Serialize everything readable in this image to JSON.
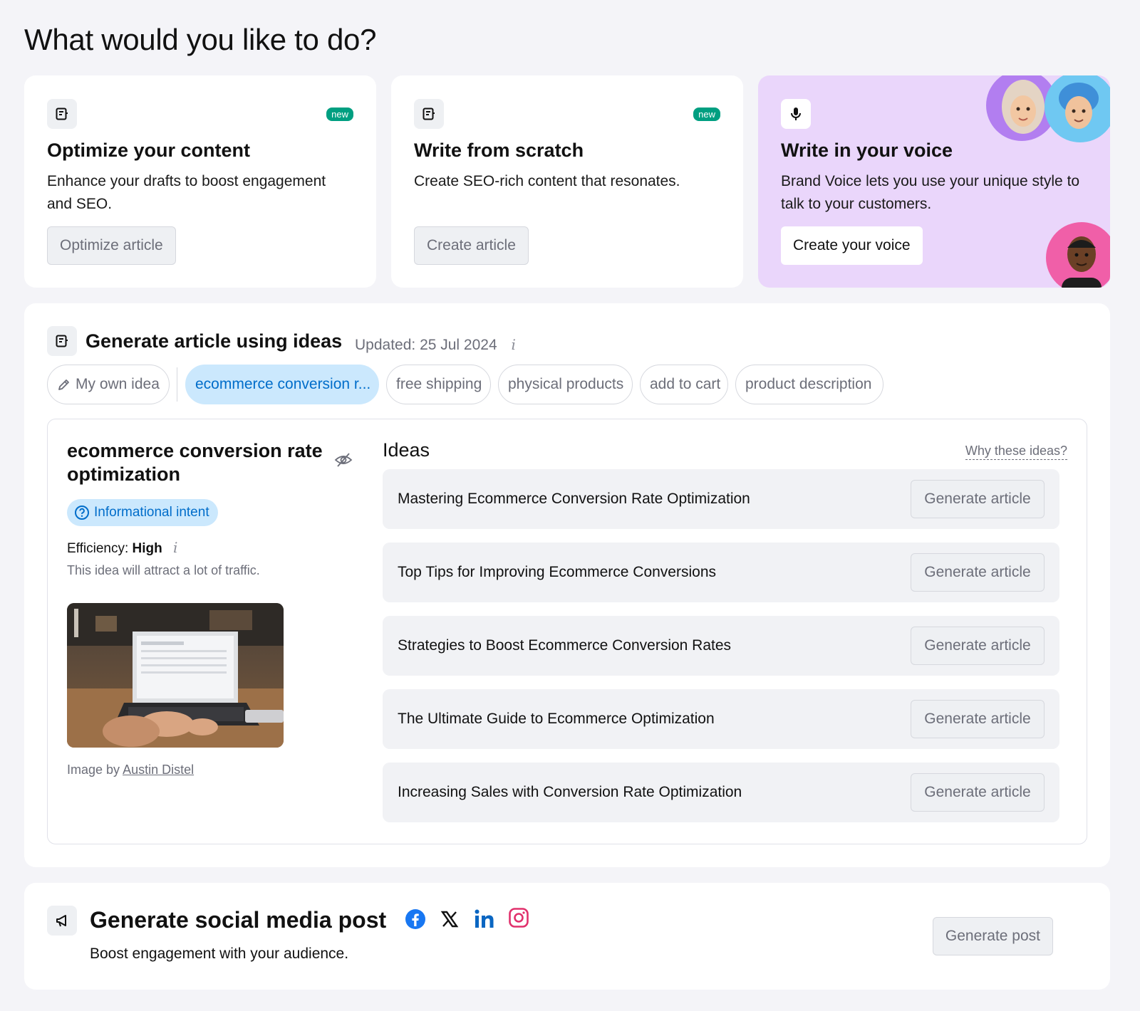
{
  "page": {
    "title": "What would you like to do?"
  },
  "cards": [
    {
      "title": "Optimize your content",
      "badge": "new",
      "description": "Enhance your drafts to boost engagement and SEO.",
      "button": "Optimize article",
      "icon": "document-icon"
    },
    {
      "title": "Write from scratch",
      "badge": "new",
      "description": "Create SEO-rich content that resonates.",
      "button": "Create article",
      "icon": "document-icon"
    },
    {
      "title": "Write in your voice",
      "description": "Brand Voice lets you use your unique style to talk to your customers.",
      "button": "Create your voice",
      "icon": "microphone-icon",
      "background": "#ead6fb"
    }
  ],
  "ideas_section": {
    "title": "Generate article using ideas",
    "updated": "Updated: 25 Jul 2024",
    "info": "i",
    "chips": [
      {
        "label": "My own idea",
        "icon": "pencil-icon",
        "active": false
      },
      {
        "label": "ecommerce conversion r...",
        "active": true
      },
      {
        "label": "free shipping",
        "active": false
      },
      {
        "label": "physical products",
        "active": false
      },
      {
        "label": "add to cart",
        "active": false
      },
      {
        "label": "product description",
        "active": false
      }
    ],
    "keyword": {
      "title": "ecommerce conversion rate optimization",
      "intent": "Informational intent",
      "efficiency_label": "Efficiency:",
      "efficiency_value": "High",
      "efficiency_note": "This idea will attract a lot of traffic.",
      "credit_prefix": "Image by",
      "credit_author": "Austin Distel"
    },
    "ideas_label": "Ideas",
    "why_link": "Why these ideas?",
    "ideas": [
      {
        "text": "Mastering Ecommerce Conversion Rate Optimization",
        "button": "Generate article"
      },
      {
        "text": "Top Tips for Improving Ecommerce Conversions",
        "button": "Generate article"
      },
      {
        "text": "Strategies to Boost Ecommerce Conversion Rates",
        "button": "Generate article"
      },
      {
        "text": "The Ultimate Guide to Ecommerce Optimization",
        "button": "Generate article"
      },
      {
        "text": "Increasing Sales with Conversion Rate Optimization",
        "button": "Generate article"
      }
    ]
  },
  "social_section": {
    "title": "Generate social media post",
    "description": "Boost engagement with your audience.",
    "button": "Generate post",
    "networks": [
      "facebook-icon",
      "x-icon",
      "linkedin-icon",
      "instagram-icon"
    ]
  },
  "colors": {
    "accent_blue": "#006dca",
    "chip_active_bg": "#cbe8fd",
    "badge_new": "#009f81",
    "voice_card_bg": "#ead6fb"
  }
}
